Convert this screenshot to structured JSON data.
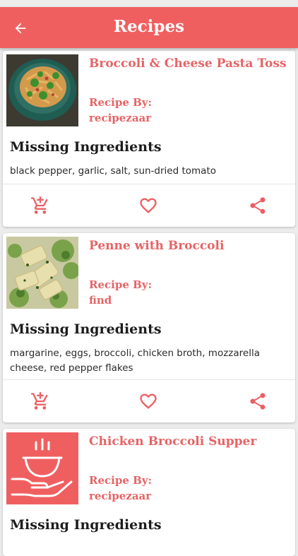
{
  "header": {
    "title": "Recipes"
  },
  "colors": {
    "accent": "#f05f60",
    "text_accent": "#e66466"
  },
  "recipes": [
    {
      "name": "Broccoli & Cheese Pasta Toss",
      "by_label": "Recipe By:",
      "by": "recipezaar",
      "missing_heading": "Missing Ingredients",
      "missing": "black pepper, garlic, salt, sun-dried tomato"
    },
    {
      "name": "Penne with Broccoli",
      "by_label": "Recipe By:",
      "by": "find",
      "missing_heading": "Missing Ingredients",
      "missing": "margarine, eggs, broccoli, chicken broth, mozzarella cheese, red pepper flakes"
    },
    {
      "name": "Chicken Broccoli Supper",
      "by_label": "Recipe By:",
      "by": "recipezaar",
      "missing_heading": "Missing Ingredients",
      "missing": ""
    }
  ],
  "icons": {
    "back": "arrow-left-icon",
    "cart": "add-to-cart-icon",
    "favorite": "heart-icon",
    "share": "share-icon",
    "placeholder": "food-bowl-icon"
  }
}
